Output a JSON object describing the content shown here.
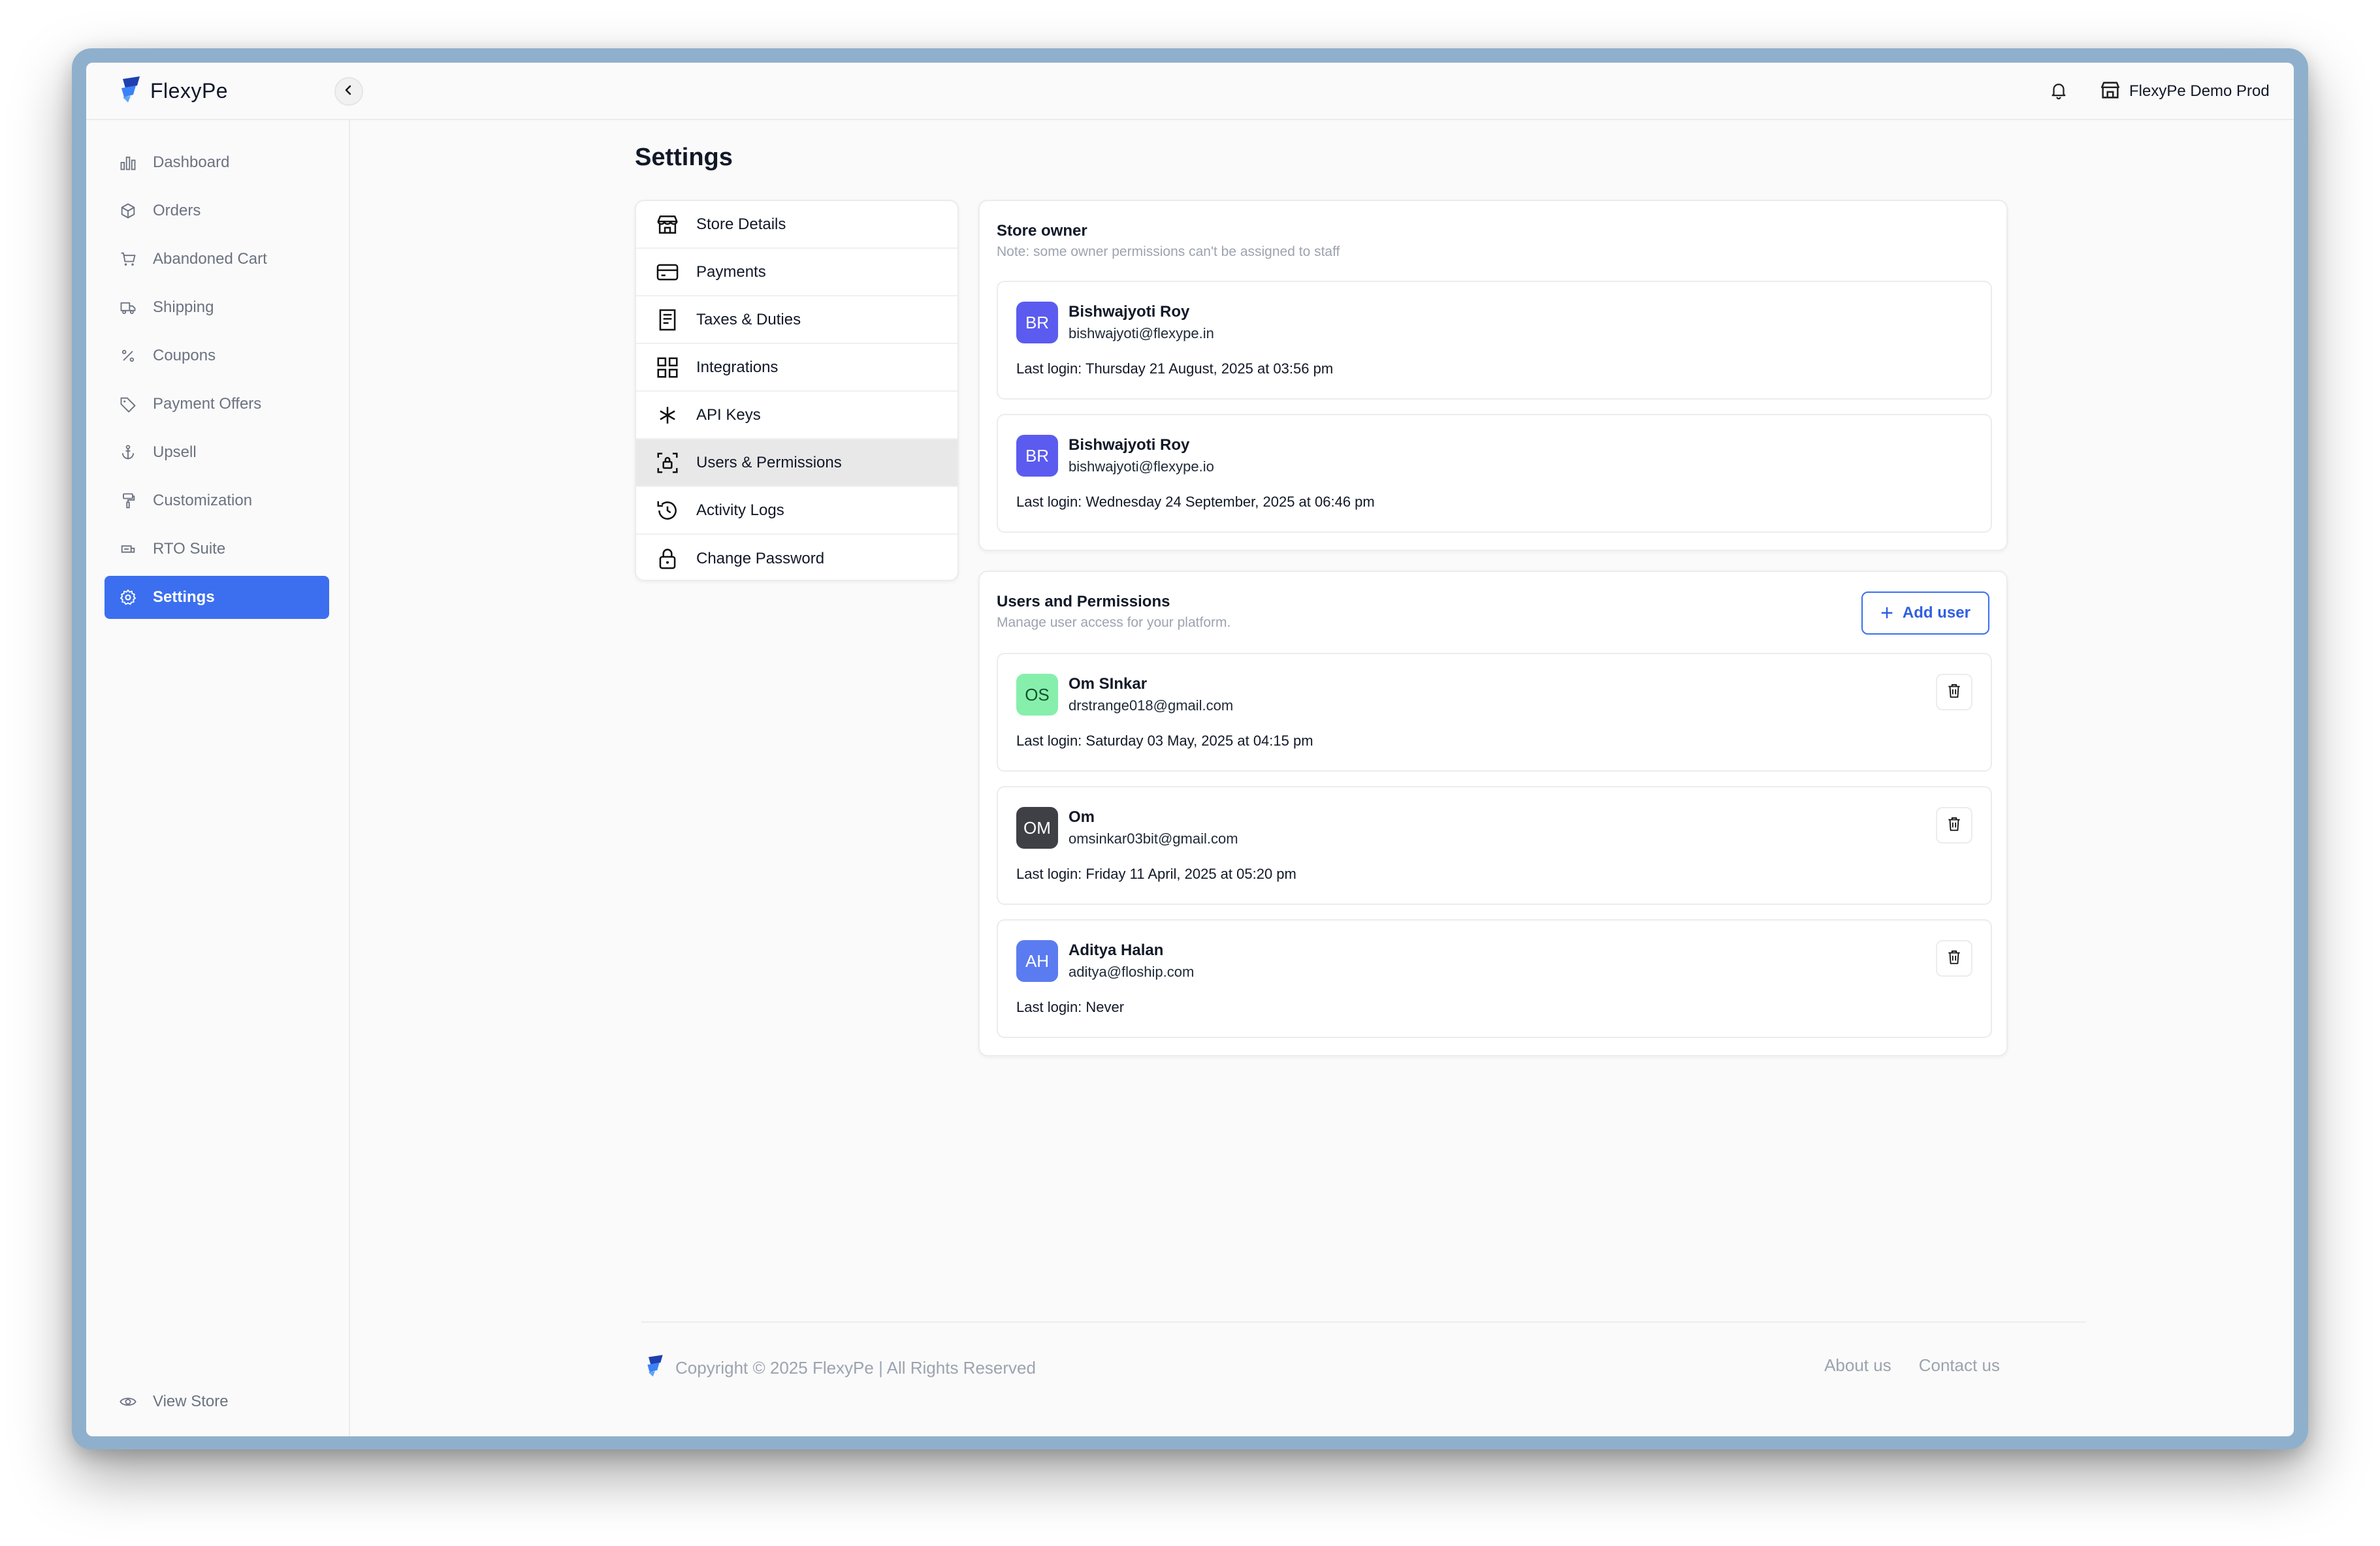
{
  "brand": {
    "name": "FlexyPe"
  },
  "topbar": {
    "store_name": "FlexyPe Demo Prod"
  },
  "sidebar": {
    "items": [
      {
        "label": "Dashboard",
        "icon": "bar-chart-icon"
      },
      {
        "label": "Orders",
        "icon": "box-icon"
      },
      {
        "label": "Abandoned Cart",
        "icon": "cart-icon"
      },
      {
        "label": "Shipping",
        "icon": "truck-icon"
      },
      {
        "label": "Coupons",
        "icon": "percent-icon"
      },
      {
        "label": "Payment Offers",
        "icon": "tag-icon"
      },
      {
        "label": "Upsell",
        "icon": "anchor-icon"
      },
      {
        "label": "Customization",
        "icon": "paint-roller-icon"
      },
      {
        "label": "RTO Suite",
        "icon": "rto-icon"
      },
      {
        "label": "Settings",
        "icon": "gear-icon",
        "active": true
      }
    ],
    "view_store": "View Store"
  },
  "page": {
    "title": "Settings"
  },
  "settings_menu": [
    {
      "label": "Store Details",
      "icon": "store-icon"
    },
    {
      "label": "Payments",
      "icon": "credit-card-icon"
    },
    {
      "label": "Taxes & Duties",
      "icon": "receipt-icon"
    },
    {
      "label": "Integrations",
      "icon": "grid-icon"
    },
    {
      "label": "API Keys",
      "icon": "asterisk-icon"
    },
    {
      "label": "Users & Permissions",
      "icon": "user-lock-icon",
      "active": true
    },
    {
      "label": "Activity Logs",
      "icon": "history-icon"
    },
    {
      "label": "Change Password",
      "icon": "lock-icon"
    }
  ],
  "store_owner": {
    "title": "Store owner",
    "note": "Note: some owner permissions can't be assigned to staff",
    "owners": [
      {
        "initials": "BR",
        "name": "Bishwajyoti Roy",
        "email": "bishwajyoti@flexype.in",
        "last_login": "Last login: Thursday 21 August, 2025 at 03:56 pm",
        "color": "#5b5bf0"
      },
      {
        "initials": "BR",
        "name": "Bishwajyoti Roy",
        "email": "bishwajyoti@flexype.io",
        "last_login": "Last login: Wednesday 24 September, 2025 at 06:46 pm",
        "color": "#5b5bf0"
      }
    ]
  },
  "users_permissions": {
    "title": "Users and Permissions",
    "subtitle": "Manage user access for your platform.",
    "add_user_label": "Add user",
    "users": [
      {
        "initials": "OS",
        "name": "Om SInkar",
        "email": "drstrange018@gmail.com",
        "last_login": "Last login: Saturday 03 May, 2025 at 04:15 pm",
        "color": "#86efac",
        "text_color": "#14532d"
      },
      {
        "initials": "OM",
        "name": "Om",
        "email": "omsinkar03bit@gmail.com",
        "last_login": "Last login: Friday 11 April, 2025 at 05:20 pm",
        "color": "#3f3f46",
        "text_color": "#ffffff"
      },
      {
        "initials": "AH",
        "name": "Aditya Halan",
        "email": "aditya@floship.com",
        "last_login": "Last login: Never",
        "color": "#5b7cf0",
        "text_color": "#ffffff"
      }
    ]
  },
  "footer": {
    "copyright": "Copyright © 2025 FlexyPe | All Rights Reserved",
    "links": [
      "About us",
      "Contact us"
    ]
  }
}
